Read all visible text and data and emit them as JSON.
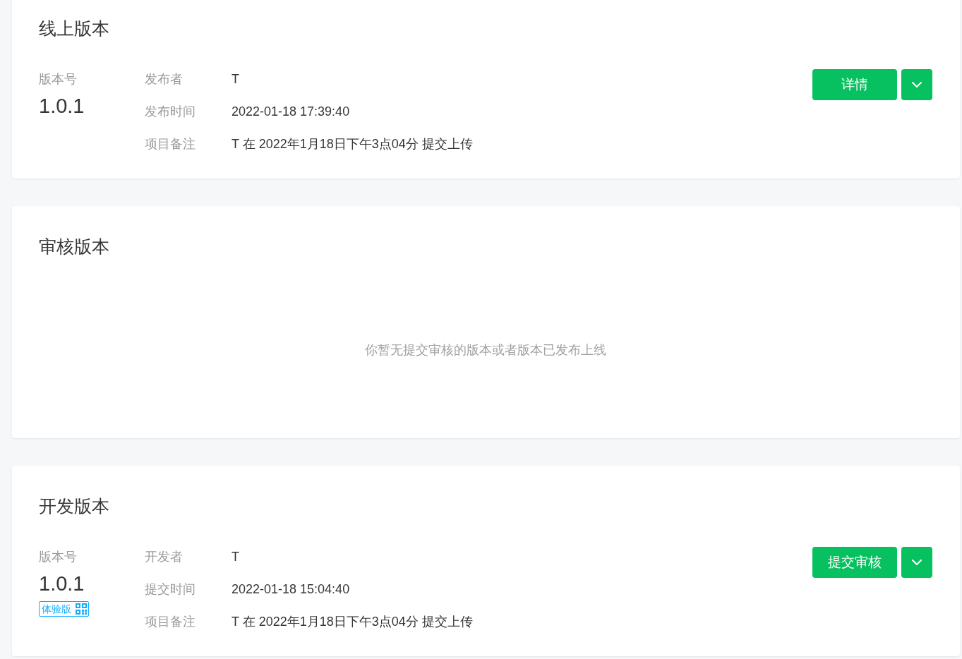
{
  "sections": [
    {
      "kind": "version",
      "title": "线上版本",
      "version_label": "版本号",
      "version": "1.0.1",
      "details": [
        {
          "label": "发布者",
          "value": "T"
        },
        {
          "label": "发布时间",
          "value": "2022-01-18 17:39:40"
        },
        {
          "label": "项目备注",
          "value": "T 在 2022年1月18日下午3点04分 提交上传"
        }
      ],
      "primary_action": "详情"
    },
    {
      "kind": "empty",
      "title": "审核版本",
      "message": "你暂无提交审核的版本或者版本已发布上线"
    },
    {
      "kind": "version",
      "title": "开发版本",
      "version_label": "版本号",
      "version": "1.0.1",
      "tag": "体验版",
      "details": [
        {
          "label": "开发者",
          "value": "T"
        },
        {
          "label": "提交时间",
          "value": "2022-01-18 15:04:40"
        },
        {
          "label": "项目备注",
          "value": "T 在 2022年1月18日下午3点04分 提交上传"
        }
      ],
      "primary_action": "提交审核"
    }
  ]
}
